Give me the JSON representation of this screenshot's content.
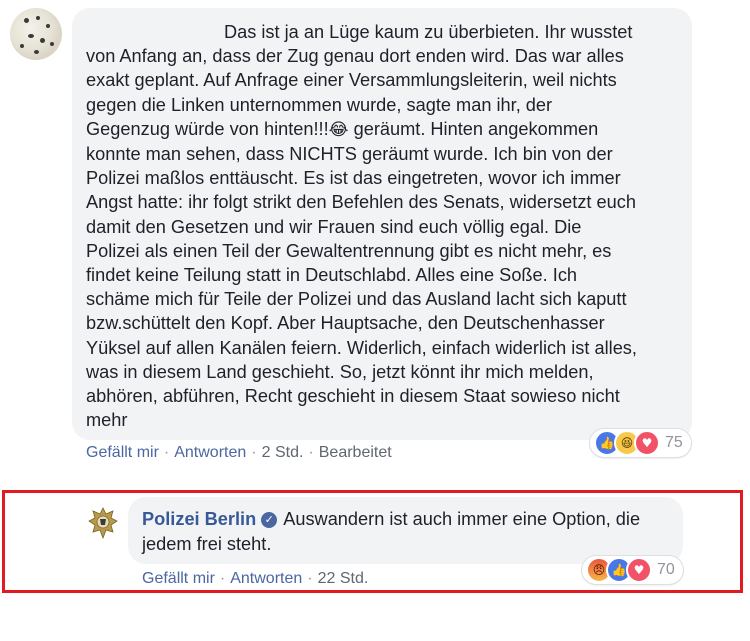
{
  "comment1": {
    "text": "Das ist ja an Lüge kaum zu überbieten. Ihr wusstet\nvon Anfang an, dass der Zug genau dort enden wird. Das war alles\nexakt geplant. Auf Anfrage einer Versammlungsleiterin, weil nichts\ngegen die Linken unternommen wurde, sagte man ihr, der\nGegenzug würde von hinten!!!",
    "text_after_emoji": " geräumt. Hinten angekommen\nkonnte man sehen, dass NICHTS geräumt wurde. Ich bin von der\nPolizei maßlos enttäuscht. Es ist das eingetreten, wovor ich immer\nAngst hatte: ihr folgt strikt den Befehlen des Senats, widersetzt euch\ndamit den Gesetzen und wir Frauen sind euch völlig egal. Die\nPolizei als einen Teil der Gewaltentrennung gibt es nicht mehr, es\nfindet keine Teilung statt in Deutschlabd. Alles eine Soße. Ich\nschäme mich für Teile der Polizei und das Ausland lacht sich kaputt\nbzw.schüttelt den Kopf. Aber Hauptsache, den Deutschenhasser\nYüksel auf allen Kanälen feiern. Widerlich, einfach widerlich ist alles,\nwas in diesem Land geschieht. So, jetzt könnt ihr mich melden,\nabhören, abführen, Recht geschieht in diesem Staat sowieso nicht\nmehr",
    "inline_emoji": "😂",
    "actions": {
      "like": "Gefällt mir",
      "reply": "Antworten",
      "time": "2 Std.",
      "edited": "Bearbeitet"
    },
    "reactions": {
      "icons": [
        "like-icon",
        "haha-icon",
        "love-icon"
      ],
      "count": "75"
    }
  },
  "comment2": {
    "author": "Polizei Berlin",
    "text": "Auswandern ist auch immer eine Option, die jedem frei steht.",
    "actions": {
      "like": "Gefällt mir",
      "reply": "Antworten",
      "time": "22 Std."
    },
    "reactions": {
      "icons": [
        "angry-icon",
        "like-icon",
        "love-icon"
      ],
      "count": "70"
    }
  },
  "colors": {
    "link": "#385898",
    "highlight_border": "#e21b23",
    "bubble": "#f2f3f5"
  }
}
